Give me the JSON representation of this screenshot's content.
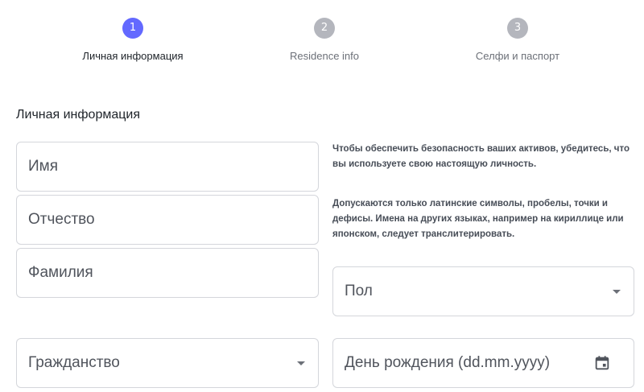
{
  "steps": [
    {
      "number": "1",
      "label": "Личная информация",
      "state": "active"
    },
    {
      "number": "2",
      "label": "Residence info",
      "state": "inactive"
    },
    {
      "number": "3",
      "label": "Селфи и паспорт",
      "state": "inactive"
    }
  ],
  "colors": {
    "accent": "#6369ff",
    "inactive_step": "#b4b6bd",
    "border": "#d4d6db"
  },
  "section_title": "Личная информация",
  "fields": {
    "first_name_placeholder": "Имя",
    "middle_name_placeholder": "Отчество",
    "last_name_placeholder": "Фамилия",
    "gender_placeholder": "Пол",
    "citizenship_placeholder": "Гражданство",
    "birthdate_placeholder": "День рождения (dd.mm.yyyy)"
  },
  "hints": {
    "security": "Чтобы обеспечить безопасность ваших активов, убедитесь, что вы используете свою настоящую личность.",
    "latin_only": "Допускаются только латинские символы, пробелы, точки и дефисы. Имена на других языках, например на кириллице или японском, следует транслитерировать."
  },
  "icons": {
    "dropdown": "chevron-down-icon",
    "calendar": "calendar-icon"
  }
}
